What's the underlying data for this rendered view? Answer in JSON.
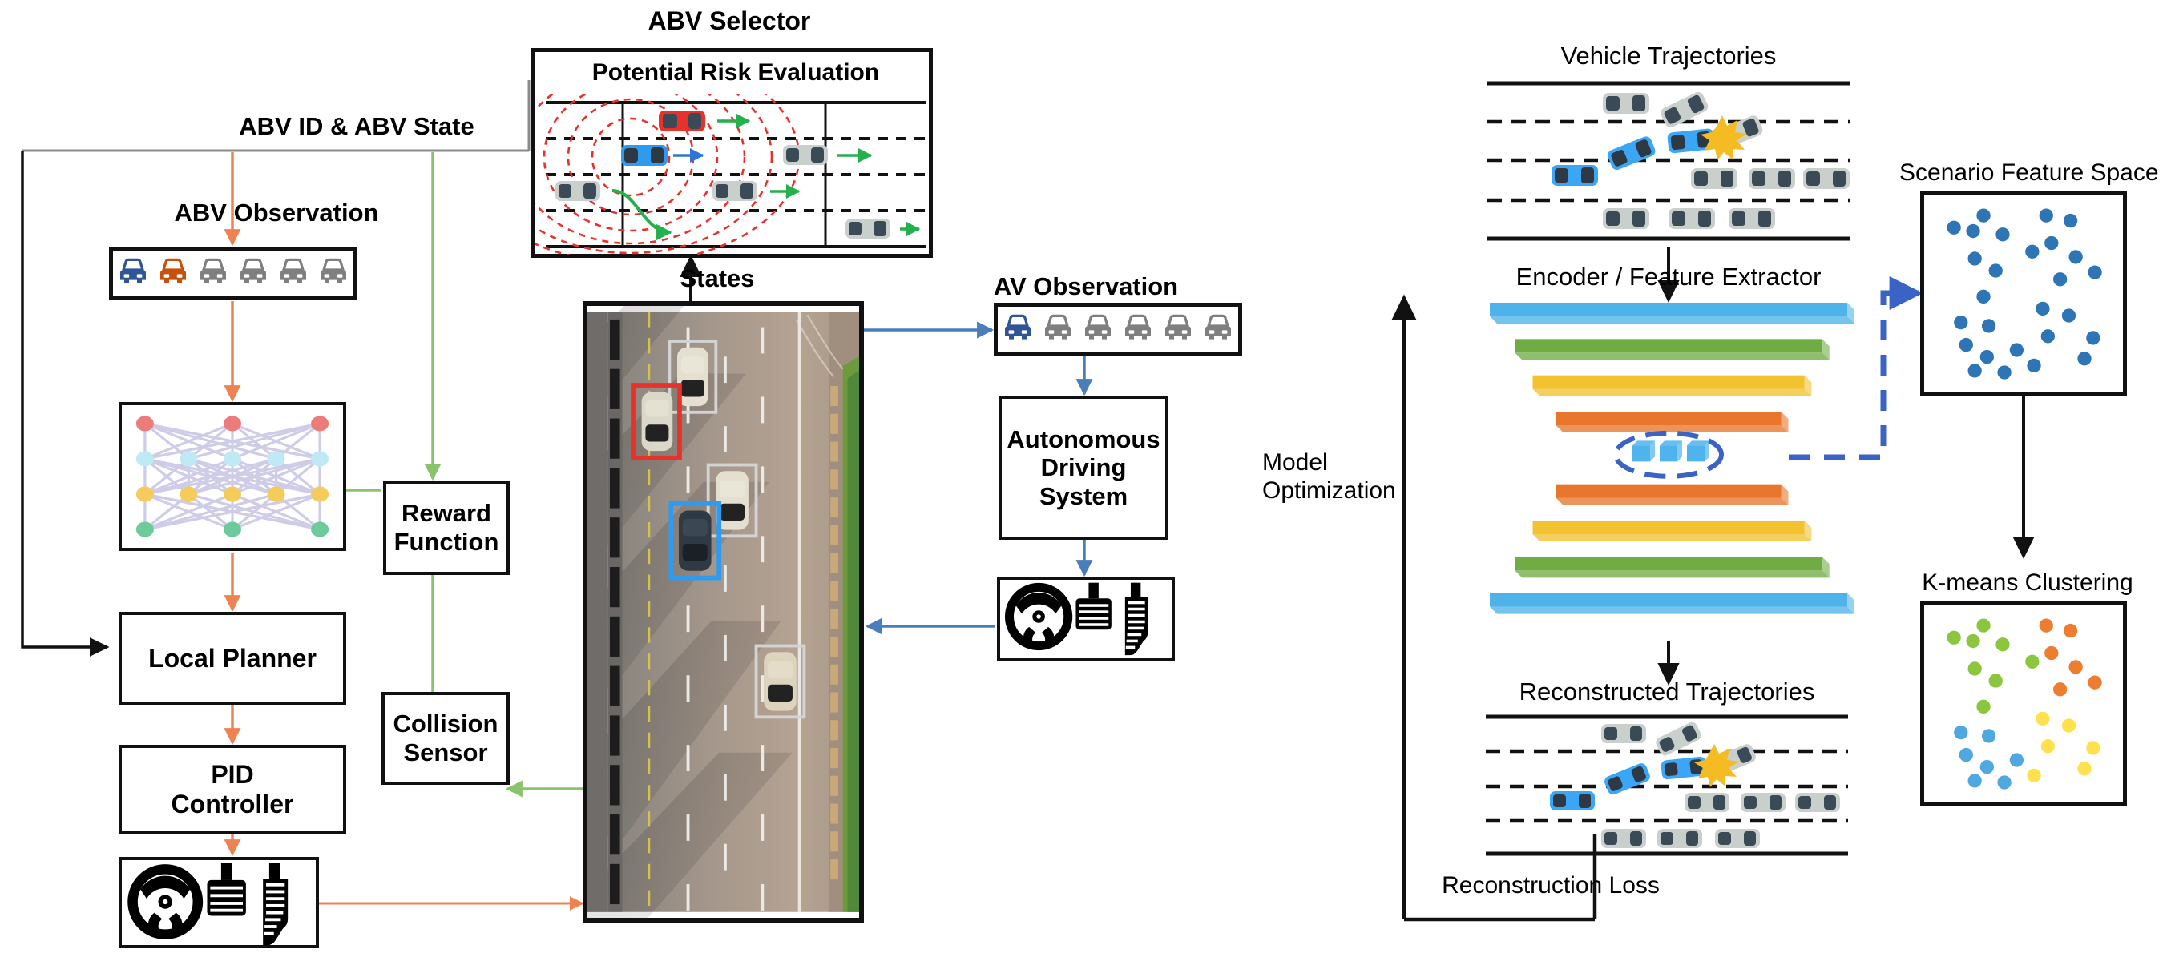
{
  "diagram": {
    "title_labels": {
      "abv_selector": "ABV Selector",
      "potential_risk_evaluation": "Potential Risk Evaluation",
      "abv_id_state": "ABV ID & ABV State",
      "abv_observation": "ABV Observation",
      "states": "States",
      "av_observation": "AV  Observation",
      "model_optimization_line1": "Model",
      "model_optimization_line2": "Optimization",
      "vehicle_trajectories": "Vehicle Trajectories",
      "encoder_feature_extractor": "Encoder / Feature Extractor",
      "reconstructed_trajectories": "Reconstructed Trajectories",
      "reconstruction_loss": "Reconstruction Loss",
      "scenario_feature_space": "Scenario Feature Space",
      "kmeans_clustering": "K-means Clustering"
    },
    "boxes": {
      "policy_network": "",
      "reward_function_line1": "Reward",
      "reward_function_line2": "Function",
      "local_planner": "Local Planner",
      "pid_controller_line1": "PID",
      "pid_controller_line2": "Controller",
      "collision_sensor_line1": "Collision",
      "collision_sensor_line2": "Sensor",
      "autonomous_driving_system_line1": "Autonomous",
      "autonomous_driving_system_line2": "Driving",
      "autonomous_driving_system_line3": "System"
    },
    "icons": {
      "steering_wheel": "steering-wheel-icon",
      "brake_pedal": "brake-pedal-icon",
      "accelerator_pedal": "accelerator-pedal-icon",
      "collision_burst": "collision-burst-icon"
    },
    "colors": {
      "arrow_orange": "#ED8253",
      "arrow_green": "#89C36B",
      "arrow_blue": "#4A7EBB",
      "arrow_black": "#111111",
      "ego_blue": "#2F5597",
      "abv_orange": "#C5510C",
      "other_gray": "#7F7F7F",
      "risk_red": "#E8312B",
      "risk_green": "#22B14C",
      "layer_blue": "#4EB3E8",
      "layer_green": "#6FAD44",
      "layer_yellow": "#F2C230",
      "layer_orange": "#E8762C",
      "latent_blue": "#4FB3EE",
      "latent_dash": "#3B63C6",
      "feature_dot": "#2E75B6",
      "cluster_green": "#8CC63F",
      "cluster_orange": "#ED7D31",
      "cluster_blue": "#4FA8E0",
      "cluster_yellow": "#FFE14D"
    }
  },
  "abv_observation_cars": [
    {
      "role": "ego",
      "color": "#2F5597"
    },
    {
      "role": "abv",
      "color": "#C5510C"
    },
    {
      "role": "other",
      "color": "#7F7F7F"
    },
    {
      "role": "other",
      "color": "#7F7F7F"
    },
    {
      "role": "other",
      "color": "#7F7F7F"
    },
    {
      "role": "other",
      "color": "#7F7F7F"
    }
  ],
  "av_observation_cars": [
    {
      "role": "ego",
      "color": "#2F5597"
    },
    {
      "role": "other",
      "color": "#7F7F7F"
    },
    {
      "role": "other",
      "color": "#7F7F7F"
    },
    {
      "role": "other",
      "color": "#7F7F7F"
    },
    {
      "role": "other",
      "color": "#7F7F7F"
    },
    {
      "role": "other",
      "color": "#7F7F7F"
    }
  ],
  "policy_network": {
    "layers": [
      {
        "name": "input",
        "count": 3,
        "color": "#EC7C7C"
      },
      {
        "name": "hidden1",
        "count": 5,
        "color": "#BFE9F5"
      },
      {
        "name": "hidden2",
        "count": 5,
        "color": "#F5CB5C"
      },
      {
        "name": "output",
        "count": 3,
        "color": "#6DCB9B"
      }
    ],
    "edge_color": "#CFCCE8"
  },
  "risk_evaluation": {
    "lane_count": 4,
    "vehicles": [
      {
        "id": "red-ego",
        "color": "#E8312B",
        "lane": 0,
        "x": 0.34,
        "arrow": "green"
      },
      {
        "id": "blue-abv",
        "color": "#2E9BF0",
        "lane": 1,
        "x": 0.22,
        "arrow": "blue"
      },
      {
        "id": "gray-1",
        "color": "#C9CFCB",
        "lane": 1,
        "x": 0.72,
        "arrow": "green"
      },
      {
        "id": "gray-2",
        "color": "#C9CFCB",
        "lane": 2,
        "x": 0.05,
        "arrow": "green-curve"
      },
      {
        "id": "gray-3",
        "color": "#C9CFCB",
        "lane": 2,
        "x": 0.5,
        "arrow": "green"
      },
      {
        "id": "gray-4",
        "color": "#C9CFCB",
        "lane": 3,
        "x": 0.85,
        "arrow": "green"
      }
    ],
    "risk_field_rings": 6,
    "risk_field_color": "#E8312B"
  },
  "autoencoder_layers": [
    {
      "index": 0,
      "color": "#4EB3E8",
      "width": 1.0
    },
    {
      "index": 1,
      "color": "#6FAD44",
      "width": 0.86
    },
    {
      "index": 2,
      "color": "#F2C230",
      "width": 0.76
    },
    {
      "index": 3,
      "color": "#E8762C",
      "width": 0.63
    },
    {
      "index": 4,
      "color": "#4FB3EE",
      "width": 0.22,
      "latent": true,
      "nodes": 3
    },
    {
      "index": 5,
      "color": "#E8762C",
      "width": 0.63
    },
    {
      "index": 6,
      "color": "#F2C230",
      "width": 0.76
    },
    {
      "index": 7,
      "color": "#6FAD44",
      "width": 0.86
    },
    {
      "index": 8,
      "color": "#4EB3E8",
      "width": 1.0
    }
  ],
  "chart_data": [
    {
      "type": "scatter",
      "title": "Scenario Feature Space",
      "xlabel": "",
      "ylabel": "",
      "grid": false,
      "legend": "none",
      "xlim": [
        0,
        1
      ],
      "ylim": [
        0,
        1
      ],
      "series": [
        {
          "name": "scenarios",
          "color": "#2E75B6",
          "points": [
            [
              0.1,
              0.88
            ],
            [
              0.21,
              0.86
            ],
            [
              0.27,
              0.95
            ],
            [
              0.38,
              0.84
            ],
            [
              0.55,
              0.74
            ],
            [
              0.63,
              0.95
            ],
            [
              0.77,
              0.92
            ],
            [
              0.66,
              0.79
            ],
            [
              0.8,
              0.71
            ],
            [
              0.91,
              0.62
            ],
            [
              0.22,
              0.7
            ],
            [
              0.34,
              0.63
            ],
            [
              0.27,
              0.48
            ],
            [
              0.71,
              0.58
            ],
            [
              0.61,
              0.41
            ],
            [
              0.76,
              0.37
            ],
            [
              0.14,
              0.33
            ],
            [
              0.3,
              0.31
            ],
            [
              0.17,
              0.2
            ],
            [
              0.46,
              0.17
            ],
            [
              0.29,
              0.13
            ],
            [
              0.64,
              0.25
            ],
            [
              0.56,
              0.08
            ],
            [
              0.9,
              0.24
            ],
            [
              0.85,
              0.12
            ],
            [
              0.22,
              0.05
            ],
            [
              0.39,
              0.04
            ]
          ]
        }
      ]
    },
    {
      "type": "scatter",
      "title": "K-means Clustering",
      "xlabel": "",
      "ylabel": "",
      "grid": false,
      "legend": "none",
      "xlim": [
        0,
        1
      ],
      "ylim": [
        0,
        1
      ],
      "series": [
        {
          "name": "cluster-1",
          "color": "#8CC63F",
          "points": [
            [
              0.1,
              0.88
            ],
            [
              0.21,
              0.86
            ],
            [
              0.27,
              0.95
            ],
            [
              0.38,
              0.84
            ],
            [
              0.55,
              0.74
            ],
            [
              0.22,
              0.7
            ],
            [
              0.34,
              0.63
            ],
            [
              0.27,
              0.48
            ]
          ]
        },
        {
          "name": "cluster-2",
          "color": "#ED7D31",
          "points": [
            [
              0.63,
              0.95
            ],
            [
              0.77,
              0.92
            ],
            [
              0.66,
              0.79
            ],
            [
              0.8,
              0.71
            ],
            [
              0.91,
              0.62
            ],
            [
              0.71,
              0.58
            ]
          ]
        },
        {
          "name": "cluster-3",
          "color": "#4FA8E0",
          "points": [
            [
              0.14,
              0.33
            ],
            [
              0.3,
              0.31
            ],
            [
              0.17,
              0.2
            ],
            [
              0.46,
              0.17
            ],
            [
              0.29,
              0.13
            ],
            [
              0.22,
              0.05
            ],
            [
              0.39,
              0.04
            ]
          ]
        },
        {
          "name": "cluster-4",
          "color": "#FFE14D",
          "points": [
            [
              0.61,
              0.41
            ],
            [
              0.76,
              0.37
            ],
            [
              0.64,
              0.25
            ],
            [
              0.56,
              0.08
            ],
            [
              0.9,
              0.24
            ],
            [
              0.85,
              0.12
            ]
          ]
        }
      ]
    }
  ],
  "trajectory_scene": {
    "lanes": 4,
    "vehicles": [
      {
        "color": "gray",
        "x": 0.21,
        "lane": 0,
        "angle": 0
      },
      {
        "color": "gray",
        "x": 0.42,
        "lane": 0.5,
        "angle": -26
      },
      {
        "color": "gray",
        "x": 0.63,
        "lane": 1.1,
        "angle": -22
      },
      {
        "color": "blue",
        "x": 0.48,
        "lane": 1.15,
        "angle": -6
      },
      {
        "color": "blue",
        "x": 0.28,
        "lane": 1.6,
        "angle": -22
      },
      {
        "color": "blue",
        "x": 0.05,
        "lane": 2.0,
        "angle": 0
      },
      {
        "color": "gray",
        "x": 0.54,
        "lane": 2.0,
        "angle": 0
      },
      {
        "color": "gray",
        "x": 0.72,
        "lane": 2.0,
        "angle": 0
      },
      {
        "color": "gray",
        "x": 0.89,
        "lane": 2.0,
        "angle": 0
      },
      {
        "color": "gray",
        "x": 0.21,
        "lane": 3.0,
        "angle": 0
      },
      {
        "color": "gray",
        "x": 0.42,
        "lane": 3.0,
        "angle": 0
      },
      {
        "color": "gray",
        "x": 0.58,
        "lane": 3.0,
        "angle": 0
      }
    ],
    "collision_marker": {
      "x": 0.585,
      "lane": 1.15,
      "color": "#F5BB23"
    }
  },
  "highway_photo": {
    "tracked_vehicles": [
      {
        "box_color": "#CCCCCC",
        "label": "other"
      },
      {
        "box_color": "#E8312B",
        "label": "abv"
      },
      {
        "box_color": "#CCCCCC",
        "label": "other"
      },
      {
        "box_color": "#2E9BF0",
        "label": "ego"
      },
      {
        "box_color": "#CCCCCC",
        "label": "other"
      }
    ]
  }
}
